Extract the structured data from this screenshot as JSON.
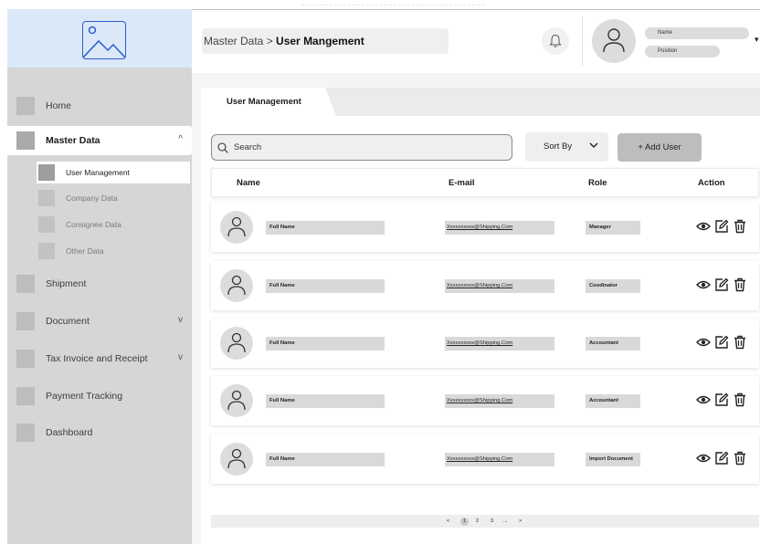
{
  "header": {
    "breadcrumb_parent": "Master Data",
    "breadcrumb_sep": " > ",
    "breadcrumb_current": "User Mangement",
    "user_name": "Name",
    "user_position": "Position"
  },
  "sidebar": {
    "items": [
      {
        "label": "Home"
      },
      {
        "label": "Master Data",
        "expanded": true,
        "chevron": "^"
      },
      {
        "label": "Shipment"
      },
      {
        "label": "Document",
        "chevron": "v"
      },
      {
        "label": "Tax Invoice and Receipt",
        "chevron": "v"
      },
      {
        "label": "Payment Tracking"
      },
      {
        "label": "Dashboard"
      }
    ],
    "sub_items": [
      {
        "label": "User Management",
        "active": true
      },
      {
        "label": "Company Data"
      },
      {
        "label": "Consignee Data"
      },
      {
        "label": "Other Data"
      }
    ]
  },
  "main": {
    "tab_label": "User Management",
    "search_placeholder": "Search",
    "sort_label": "Sort By",
    "add_user_label": "+ Add User",
    "columns": [
      "Name",
      "E-mail",
      "Role",
      "Action"
    ],
    "rows": [
      {
        "name": "Full Name",
        "email": "Xxxxxxxxxx@Shipping.Com",
        "role": "Manager"
      },
      {
        "name": "Full Name",
        "email": "Xxxxxxxxxx@Shipping.Com",
        "role": "Coodinator"
      },
      {
        "name": "Full Name",
        "email": "Xxxxxxxxxx@Shipping.Com",
        "role": "Accountant"
      },
      {
        "name": "Full Name",
        "email": "Xxxxxxxxxx@Shipping.Com",
        "role": "Accountant"
      },
      {
        "name": "Full Name",
        "email": "Xxxxxxxxxx@Shipping.Com",
        "role": "Import Document"
      }
    ],
    "pagination": {
      "prev": "<",
      "pages": [
        "1",
        "2",
        "3",
        "..."
      ],
      "current": "1",
      "next": ">"
    }
  },
  "icons": {
    "logo": "image-icon",
    "notification": "bell-icon",
    "search": "search-icon",
    "view": "eye-icon",
    "edit": "edit-icon",
    "delete": "trash-icon"
  },
  "colors": {
    "logo_bg": "#dbe8f8",
    "logo_stroke": "#2f5bd3",
    "sidebar_bg": "#d6d6d6",
    "add_button": "#bdbdbd"
  }
}
